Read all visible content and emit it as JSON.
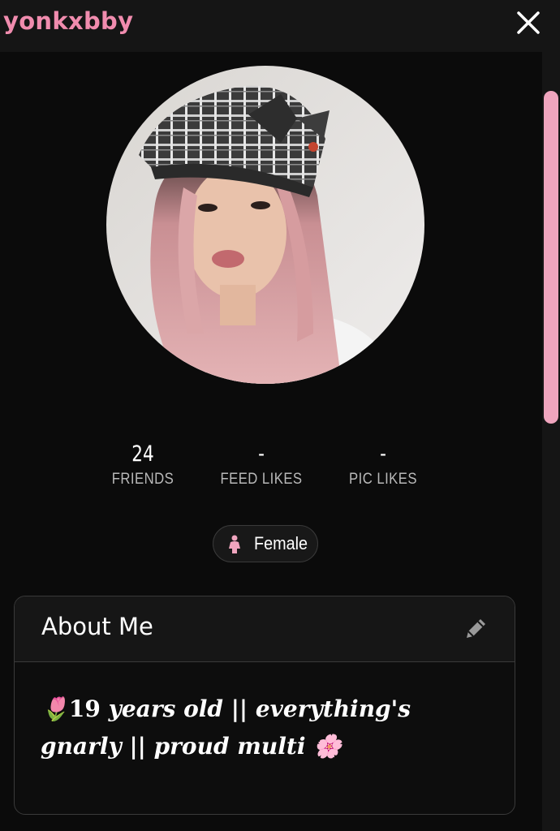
{
  "header": {
    "title": "yonkxbby",
    "close_icon": "close-icon"
  },
  "profile": {
    "avatar_alt": "profile photo",
    "stats": [
      {
        "value": "24",
        "label": "FRIENDS"
      },
      {
        "value": "-",
        "label": "FEED LIKES"
      },
      {
        "value": "-",
        "label": "PIC LIKES"
      }
    ],
    "gender": {
      "label": "Female",
      "icon": "female-icon",
      "color": "#f0a5be"
    }
  },
  "about": {
    "title": "About Me",
    "edit_icon": "pencil-icon",
    "emoji_start": "🌷",
    "age_number": "19",
    "text": " years old || everything's gnarly || proud multi ",
    "emoji_end": "🌸"
  },
  "colors": {
    "accent": "#f08cae",
    "scrollbar": "#f0a5be",
    "background": "#0b0b0b"
  }
}
